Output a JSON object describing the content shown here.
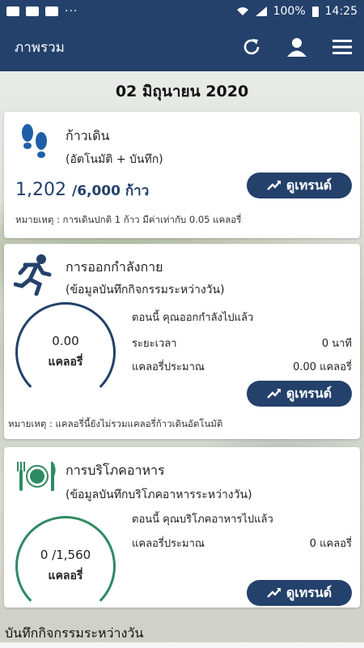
{
  "status_bar": {
    "battery": "100%",
    "time": "14:25",
    "dots": "···"
  },
  "app_bar": {
    "title": "ภาพรวม",
    "icons": [
      "refresh-icon",
      "person-icon",
      "menu-icon"
    ]
  },
  "date": "02 มิถุนายน 2020",
  "steps_card": {
    "title": "ก้าวเดิน",
    "subtitle": "(อัตโนมัติ + บันทึก)",
    "current": "1,202",
    "goal": "/6,000 ก้าว",
    "button_label": "ดูเทรนด์",
    "note": "หมายเหตุ : การเดินปกติ 1 ก้าว มีค่าเท่ากับ 0.05 แคลอรี่"
  },
  "exercise_card": {
    "title": "การออกกำลังกาย",
    "subtitle": "(ข้อมูลบันทึกกิจกรรมระหว่างวัน)",
    "ring_value": "0.00",
    "ring_unit": "แคลอรี่",
    "heading": "ตอนนี้ คุณออกกำลังไปแล้ว",
    "rows": [
      {
        "label": "ระยะเวลา",
        "value": "0 นาที"
      },
      {
        "label": "แคลอรี่ประมาณ",
        "value": "0.00 แคลอรี่"
      }
    ],
    "button_label": "ดูเทรนด์",
    "note": "หมายเหตุ : แคลอรี่นี้ยังไม่รวมแคลอรี่ก้าวเดินอัตโนมัติ"
  },
  "food_card": {
    "title": "การบริโภคอาหาร",
    "subtitle": "(ข้อมูลบันทึกบริโภคอาหารระหว่างวัน)",
    "ring_value": "0 /1,560",
    "ring_unit": "แคลอรี่",
    "heading": "ตอนนี้ คุณบริโภคอาหารไปแล้ว",
    "rows": [
      {
        "label": "แคลอรี่ประมาณ",
        "value": "0 แคลอรี่"
      }
    ],
    "button_label": "ดูเทรนด์"
  },
  "bottom_section": "บันทึกกิจกรรมระหว่างวัน",
  "colors": {
    "primary": "#23416b",
    "food_green": "#2e8a62",
    "steps_blue": "#1f5fa8"
  }
}
